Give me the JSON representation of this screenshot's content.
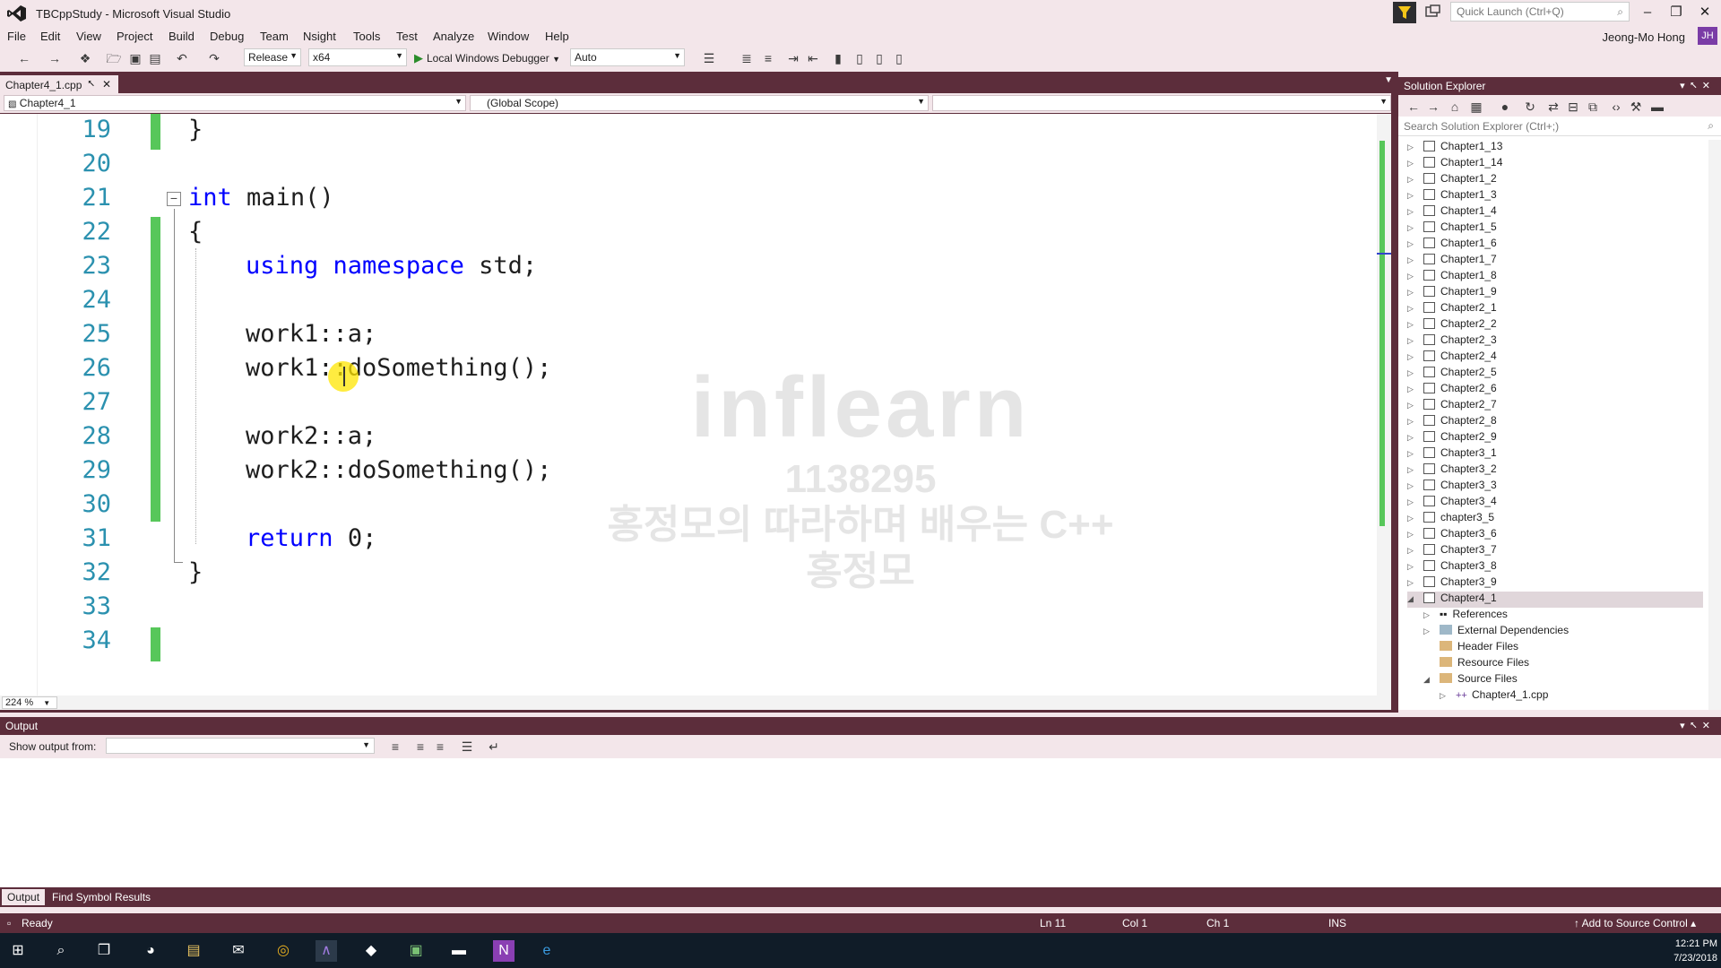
{
  "window": {
    "title": "TBCppStudy - Microsoft Visual Studio",
    "quick_launch_placeholder": "Quick Launch (Ctrl+Q)",
    "user": "Jeong-Mo Hong",
    "user_initials": "JH"
  },
  "menu": [
    "File",
    "Edit",
    "View",
    "Project",
    "Build",
    "Debug",
    "Team",
    "Nsight",
    "Tools",
    "Test",
    "Analyze",
    "Window",
    "Help"
  ],
  "toolbar": {
    "configuration": "Release",
    "platform": "x64",
    "debugger": "Local Windows Debugger",
    "debug_mode": "Auto"
  },
  "document": {
    "tab_label": "Chapter4_1.cpp",
    "project_scope": "Chapter4_1",
    "scope": "(Global Scope)",
    "zoom": "224 %"
  },
  "code": {
    "lines": [
      {
        "n": "19",
        "text": "}"
      },
      {
        "n": "20",
        "text": ""
      },
      {
        "n": "21",
        "text": "int main()"
      },
      {
        "n": "22",
        "text": "{"
      },
      {
        "n": "23",
        "text": "using namespace std;"
      },
      {
        "n": "24",
        "text": ""
      },
      {
        "n": "25",
        "text": "work1::a;"
      },
      {
        "n": "26",
        "text": "work1::doSomething();"
      },
      {
        "n": "27",
        "text": ""
      },
      {
        "n": "28",
        "text": "work2::a;"
      },
      {
        "n": "29",
        "text": "work2::doSomething();"
      },
      {
        "n": "30",
        "text": ""
      },
      {
        "n": "31",
        "text": "return 0;"
      },
      {
        "n": "32",
        "text": "}"
      },
      {
        "n": "33",
        "text": ""
      },
      {
        "n": "34",
        "text": ""
      }
    ]
  },
  "solution_explorer": {
    "title": "Solution Explorer",
    "search_placeholder": "Search Solution Explorer (Ctrl+;)",
    "projects": [
      "Chapter1_13",
      "Chapter1_14",
      "Chapter1_2",
      "Chapter1_3",
      "Chapter1_4",
      "Chapter1_5",
      "Chapter1_6",
      "Chapter1_7",
      "Chapter1_8",
      "Chapter1_9",
      "Chapter2_1",
      "Chapter2_2",
      "Chapter2_3",
      "Chapter2_4",
      "Chapter2_5",
      "Chapter2_6",
      "Chapter2_7",
      "Chapter2_8",
      "Chapter2_9",
      "Chapter3_1",
      "Chapter3_2",
      "Chapter3_3",
      "Chapter3_4",
      "chapter3_5",
      "Chapter3_6",
      "Chapter3_7",
      "Chapter3_8",
      "Chapter3_9"
    ],
    "selected_project": "Chapter4_1",
    "children": [
      "References",
      "External Dependencies",
      "Header Files",
      "Resource Files",
      "Source Files"
    ],
    "source_file": "Chapter4_1.cpp"
  },
  "output": {
    "title": "Output",
    "show_output_from": "Show output from:"
  },
  "bottom_tabs": [
    "Output",
    "Find Symbol Results"
  ],
  "status": {
    "ready": "Ready",
    "ln": "Ln 11",
    "col": "Col 1",
    "ch": "Ch 1",
    "mode": "INS",
    "source_control": "Add to Source Control"
  },
  "clock": {
    "time": "12:21 PM",
    "date": "7/23/2018"
  },
  "watermark": {
    "brand": "inflearn",
    "id": "1138295",
    "course": "홍정모의 따라하며 배우는 C++",
    "author": "홍정모"
  },
  "colors": {
    "accent": "#5c2d3b",
    "chrome": "#f3e6ea",
    "keyword": "#0000ff",
    "line_number": "#2b91af",
    "change_marker": "#57c75a"
  }
}
